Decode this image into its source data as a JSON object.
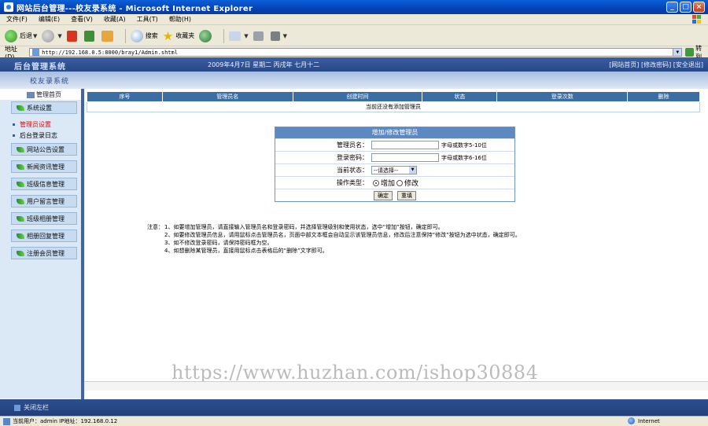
{
  "window": {
    "title": "网站后台管理---校友录系统 - Microsoft Internet Explorer",
    "min": "_",
    "max": "□",
    "close": "×"
  },
  "menu": [
    "文件(F)",
    "编辑(E)",
    "查看(V)",
    "收藏(A)",
    "工具(T)",
    "帮助(H)"
  ],
  "toolbar": {
    "back": "后退",
    "search": "搜索",
    "favorites": "收藏夹"
  },
  "address": {
    "label": "地址(D)",
    "url": "http://192.168.0.5:8000/bray1/Admin.shtml",
    "go": "转到"
  },
  "header": {
    "system_name": "后台管理系统",
    "date": "2009年4月7日 星期二 丙戌年 七月十二",
    "links": "[网站首页] [修改密码] [安全退出]",
    "subtitle": "校友录系统"
  },
  "sidebar": {
    "home": "管理首页",
    "items": [
      {
        "label": "系统设置"
      },
      {
        "label": "管理员设置"
      },
      {
        "label": "后台登录日志"
      },
      {
        "label": "网站公告设置"
      },
      {
        "label": "新闻资讯管理"
      },
      {
        "label": "班级信息管理"
      },
      {
        "label": "用户留言管理"
      },
      {
        "label": "班级相册管理"
      },
      {
        "label": "相册回复管理"
      },
      {
        "label": "注册会员管理"
      }
    ]
  },
  "admin_table": {
    "headers": [
      "序号",
      "管理员名",
      "创建时间",
      "状态",
      "登录次数",
      "删除"
    ],
    "empty_message": "当前还没有添加管理员"
  },
  "form": {
    "title": "增加/修改管理员",
    "username_label": "管理员名：",
    "username_hint": "字母或数字5-10位",
    "password_label": "登录密码：",
    "password_hint": "字母或数字6-16位",
    "status_label": "当前状态：",
    "status_value": "--请选择--",
    "action_label": "操作类型：",
    "action_add": "增加",
    "action_edit": "修改",
    "submit": "确定",
    "reset": "重填"
  },
  "notes": {
    "title": "注意：",
    "items": [
      "1、如要增加管理员，请直接输入管理员名和登录密码，并选择管理级别和使用状态，选中“增加”按钮，确定即可。",
      "2、如要修改管理员信息，请用鼠标点击管理员名，页面中部文本框会自动显示该管理员信息，修改后注意保持“修改”按钮为选中状态，确定即可。",
      "3、如不修改登录密码，请保持密码框为空。",
      "4、如想删除某管理员，直接用鼠标点击表格后的“删除”文字即可。"
    ]
  },
  "watermark": "https://www.huzhan.com/ishop30884",
  "footer": {
    "close_sidebar": "关闭左栏"
  },
  "status": {
    "left": "当前用户：admin  IP地址：192.168.0.12",
    "zone": "Internet"
  }
}
